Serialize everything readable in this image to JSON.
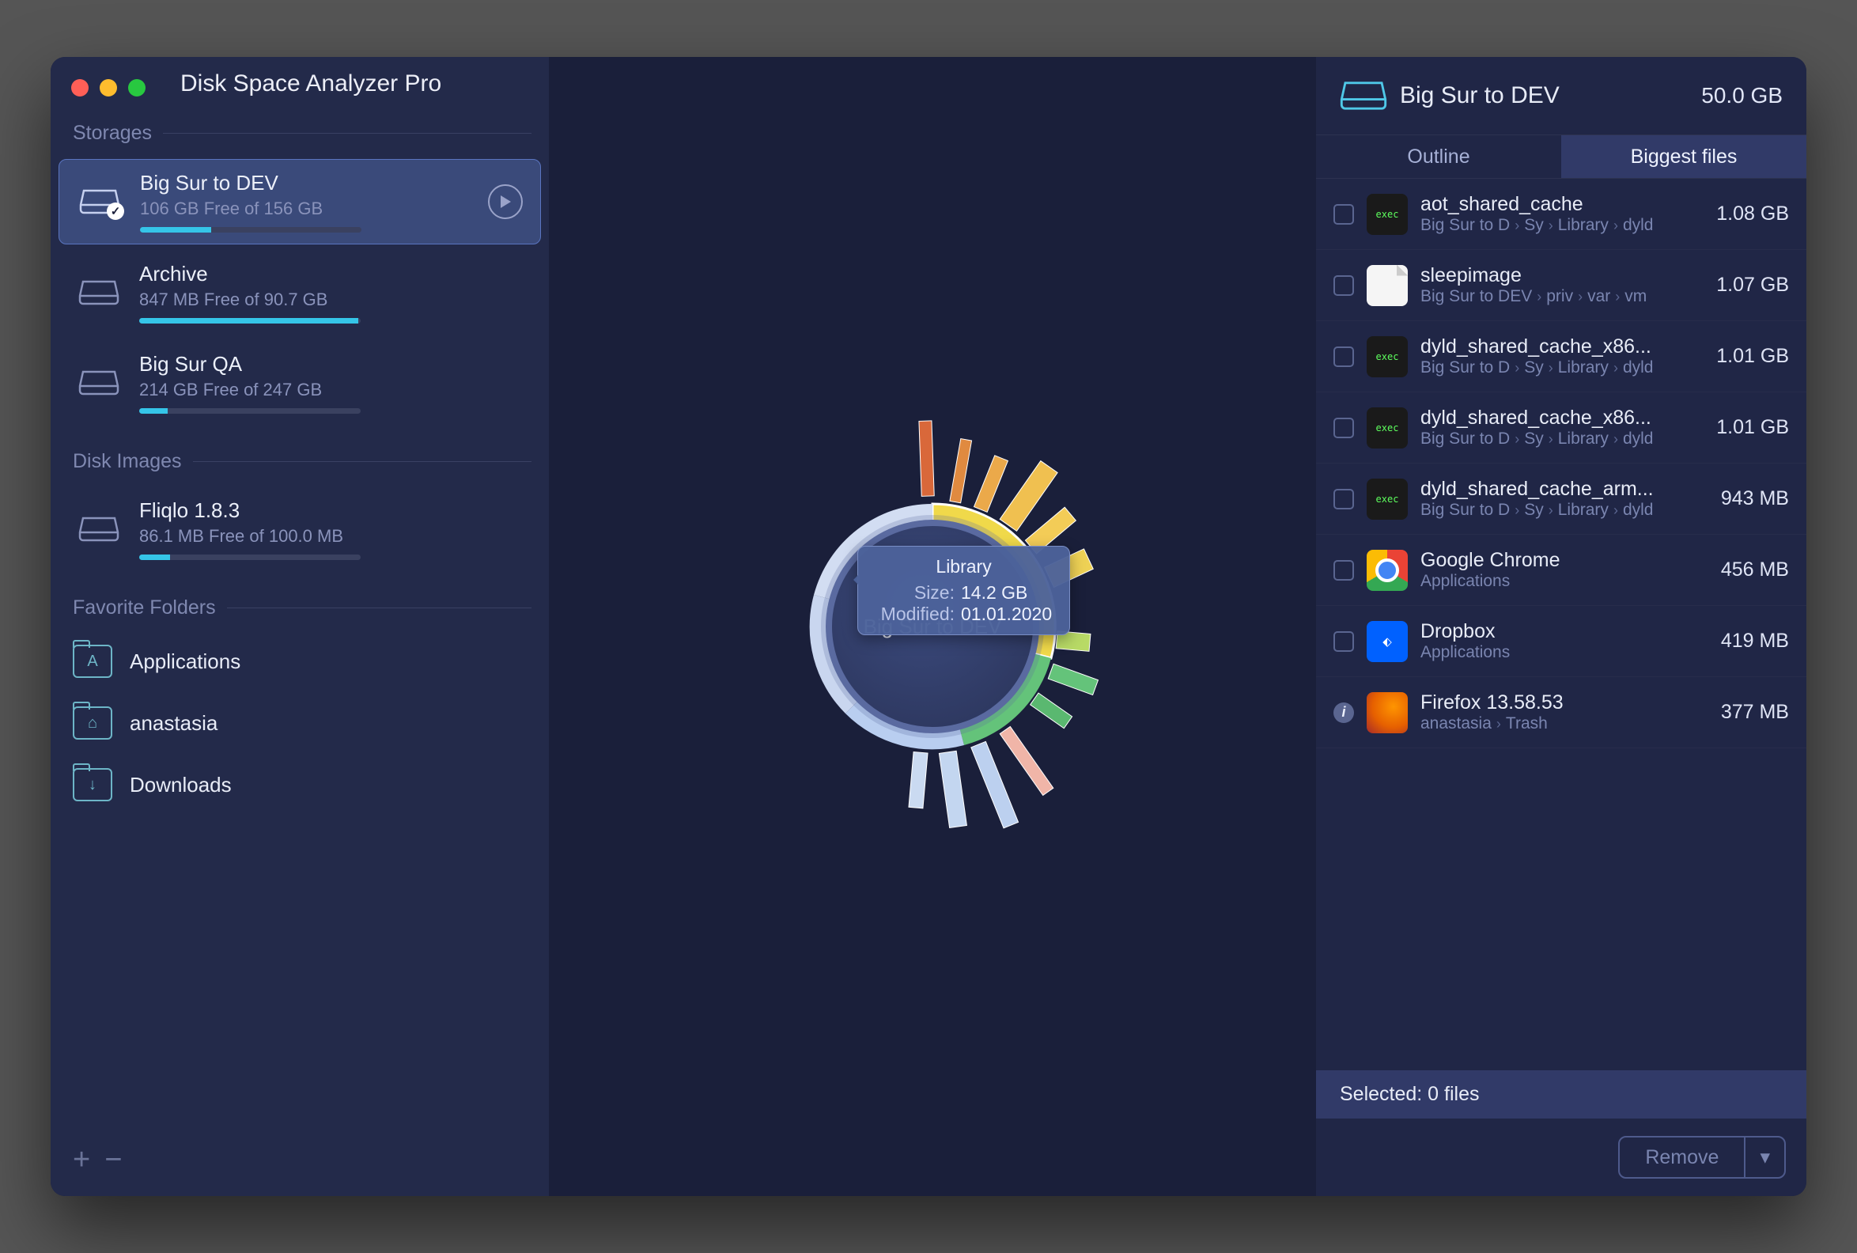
{
  "app_title": "Disk Space Analyzer Pro",
  "sidebar": {
    "sections": {
      "storages_label": "Storages",
      "disk_images_label": "Disk Images",
      "favorites_label": "Favorite Folders"
    },
    "storages": [
      {
        "name": "Big Sur to DEV",
        "free_text": "106 GB Free of 156 GB",
        "fill_pct": 32,
        "selected": true,
        "has_play": true,
        "has_check": true
      },
      {
        "name": "Archive",
        "free_text": "847 MB Free of 90.7 GB",
        "fill_pct": 99,
        "selected": false
      },
      {
        "name": "Big Sur QA",
        "free_text": "214 GB Free of 247 GB",
        "fill_pct": 13,
        "selected": false
      }
    ],
    "disk_images": [
      {
        "name": "Fliqlo 1.8.3",
        "free_text": "86.1 MB Free of 100.0 MB",
        "fill_pct": 14
      }
    ],
    "favorites": [
      {
        "name": "Applications",
        "icon": "A"
      },
      {
        "name": "anastasia",
        "icon": "⌂"
      },
      {
        "name": "Downloads",
        "icon": "↓"
      }
    ]
  },
  "center": {
    "label": "Big Sur to DEV",
    "tooltip": {
      "title": "Library",
      "size_label": "Size:",
      "size_value": "14.2 GB",
      "modified_label": "Modified:",
      "modified_value": "01.01.2020"
    }
  },
  "right": {
    "drive_name": "Big Sur to DEV",
    "drive_size": "50.0 GB",
    "tabs": {
      "outline": "Outline",
      "biggest": "Biggest files"
    },
    "files": [
      {
        "name": "aot_shared_cache",
        "size": "1.08 GB",
        "icon": "exec",
        "path": [
          "Big Sur to D",
          "Sy",
          "Library",
          "dyld"
        ]
      },
      {
        "name": "sleepimage",
        "size": "1.07 GB",
        "icon": "blank",
        "path": [
          "Big Sur to DEV",
          "priv",
          "var",
          "vm"
        ]
      },
      {
        "name": "dyld_shared_cache_x86...",
        "size": "1.01 GB",
        "icon": "exec",
        "path": [
          "Big Sur to D",
          "Sy",
          "Library",
          "dyld"
        ]
      },
      {
        "name": "dyld_shared_cache_x86...",
        "size": "1.01 GB",
        "icon": "exec",
        "path": [
          "Big Sur to D",
          "Sy",
          "Library",
          "dyld"
        ]
      },
      {
        "name": "dyld_shared_cache_arm...",
        "size": "943 MB",
        "icon": "exec",
        "path": [
          "Big Sur to D",
          "Sy",
          "Library",
          "dyld"
        ]
      },
      {
        "name": "Google Chrome",
        "size": "456 MB",
        "icon": "chrome",
        "path": [
          "Applications"
        ]
      },
      {
        "name": "Dropbox",
        "size": "419 MB",
        "icon": "dropbox",
        "path": [
          "Applications"
        ]
      },
      {
        "name": "Firefox 13.58.53",
        "size": "377 MB",
        "icon": "firefox",
        "path": [
          "anastasia",
          "Trash"
        ],
        "info": true
      }
    ],
    "selected_text": "Selected: 0 files",
    "remove_label": "Remove"
  },
  "chart_data": {
    "type": "sunburst",
    "center_label": "Big Sur to DEV",
    "highlighted_segment": {
      "name": "Library",
      "size_gb": 14.2,
      "modified": "01.01.2020"
    },
    "segments_note": "Multi-ring sunburst of disk contents; inner ring = top-level folders, outer bars = subfolder sizes. Exact per-segment values not labeled in source image."
  }
}
